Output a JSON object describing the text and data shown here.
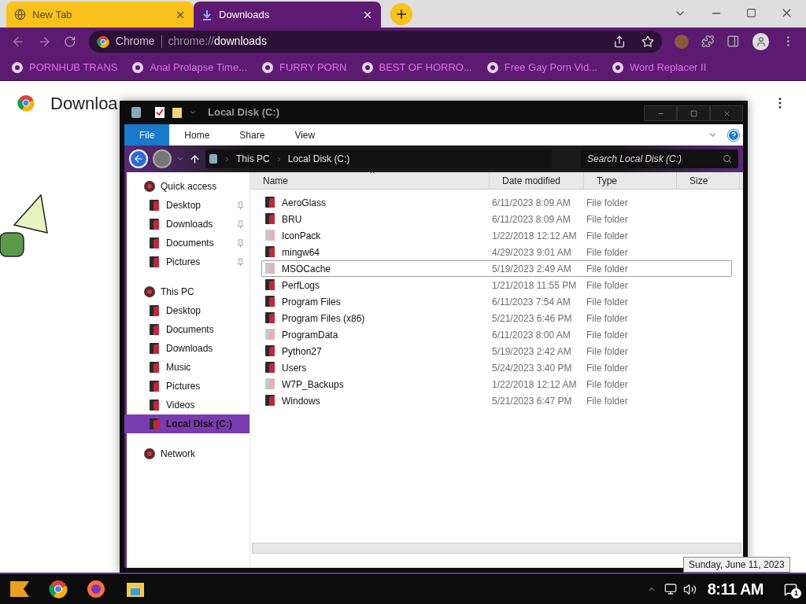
{
  "browser": {
    "tabs": [
      {
        "title": "New Tab",
        "selected": false
      },
      {
        "title": "Downloads",
        "selected": true
      }
    ],
    "omnibox": {
      "site_label": "Chrome",
      "url_scheme": "chrome://",
      "url_path": "downloads"
    },
    "bookmarks": [
      "PORNHUB TRANS",
      "Anal Prolapse Time...",
      "FURRY PORN",
      "BEST OF HORRO...",
      "Free Gay Porn Vid...",
      "Word Replacer II"
    ],
    "page": {
      "title": "Downloa"
    }
  },
  "explorer": {
    "title": "Local Disk (C:)",
    "ribbon_tabs": [
      {
        "label": "File",
        "selected": true
      },
      {
        "label": "Home",
        "selected": false
      },
      {
        "label": "Share",
        "selected": false
      },
      {
        "label": "View",
        "selected": false
      }
    ],
    "breadcrumbs": [
      "This PC",
      "Local Disk (C:)"
    ],
    "search": {
      "placeholder": "Search Local Disk (C:)"
    },
    "nav": [
      {
        "label": "Quick access",
        "selected": false,
        "children": [
          {
            "label": "Desktop",
            "pinned": true,
            "selected": false
          },
          {
            "label": "Downloads",
            "pinned": true,
            "selected": false
          },
          {
            "label": "Documents",
            "pinned": true,
            "selected": false
          },
          {
            "label": "Pictures",
            "pinned": true,
            "selected": false
          }
        ]
      },
      {
        "label": "This PC",
        "selected": false,
        "children": [
          {
            "label": "Desktop",
            "pinned": false,
            "selected": false
          },
          {
            "label": "Documents",
            "pinned": false,
            "selected": false
          },
          {
            "label": "Downloads",
            "pinned": false,
            "selected": false
          },
          {
            "label": "Music",
            "pinned": false,
            "selected": false
          },
          {
            "label": "Pictures",
            "pinned": false,
            "selected": false
          },
          {
            "label": "Videos",
            "pinned": false,
            "selected": false
          },
          {
            "label": "Local Disk (C:)",
            "pinned": false,
            "selected": true
          }
        ]
      },
      {
        "label": "Network",
        "selected": false
      }
    ],
    "columns": [
      "Name",
      "Date modified",
      "Type",
      "Size"
    ],
    "rows": [
      {
        "name": "AeroGlass",
        "date": "6/11/2023 8:09 AM",
        "type": "File folder",
        "hidden": false,
        "selected": false
      },
      {
        "name": "BRU",
        "date": "6/11/2023 8:09 AM",
        "type": "File folder",
        "hidden": false,
        "selected": false
      },
      {
        "name": "IconPack",
        "date": "1/22/2018 12:12 AM",
        "type": "File folder",
        "hidden": true,
        "selected": false
      },
      {
        "name": "mingw64",
        "date": "4/29/2023 9:01 AM",
        "type": "File folder",
        "hidden": false,
        "selected": false
      },
      {
        "name": "MSOCache",
        "date": "5/19/2023 2:49 AM",
        "type": "File folder",
        "hidden": true,
        "selected": true
      },
      {
        "name": "PerfLogs",
        "date": "1/21/2018 11:55 PM",
        "type": "File folder",
        "hidden": false,
        "selected": false
      },
      {
        "name": "Program Files",
        "date": "6/11/2023 7:54 AM",
        "type": "File folder",
        "hidden": false,
        "selected": false
      },
      {
        "name": "Program Files (x86)",
        "date": "5/21/2023 6:46 PM",
        "type": "File folder",
        "hidden": false,
        "selected": false
      },
      {
        "name": "ProgramData",
        "date": "6/11/2023 8:00 AM",
        "type": "File folder",
        "hidden": true,
        "selected": false
      },
      {
        "name": "Python27",
        "date": "5/19/2023 2:42 AM",
        "type": "File folder",
        "hidden": false,
        "selected": false
      },
      {
        "name": "Users",
        "date": "5/24/2023 3:40 PM",
        "type": "File folder",
        "hidden": false,
        "selected": false
      },
      {
        "name": "W7P_Backups",
        "date": "1/22/2018 12:12 AM",
        "type": "File folder",
        "hidden": true,
        "selected": false
      },
      {
        "name": "Windows",
        "date": "5/21/2023 6:47 PM",
        "type": "File folder",
        "hidden": false,
        "selected": false
      }
    ]
  },
  "taskbar": {
    "tooltip": "Sunday, June 11, 2023",
    "clock": "8:11 AM",
    "notification_count": "1"
  }
}
